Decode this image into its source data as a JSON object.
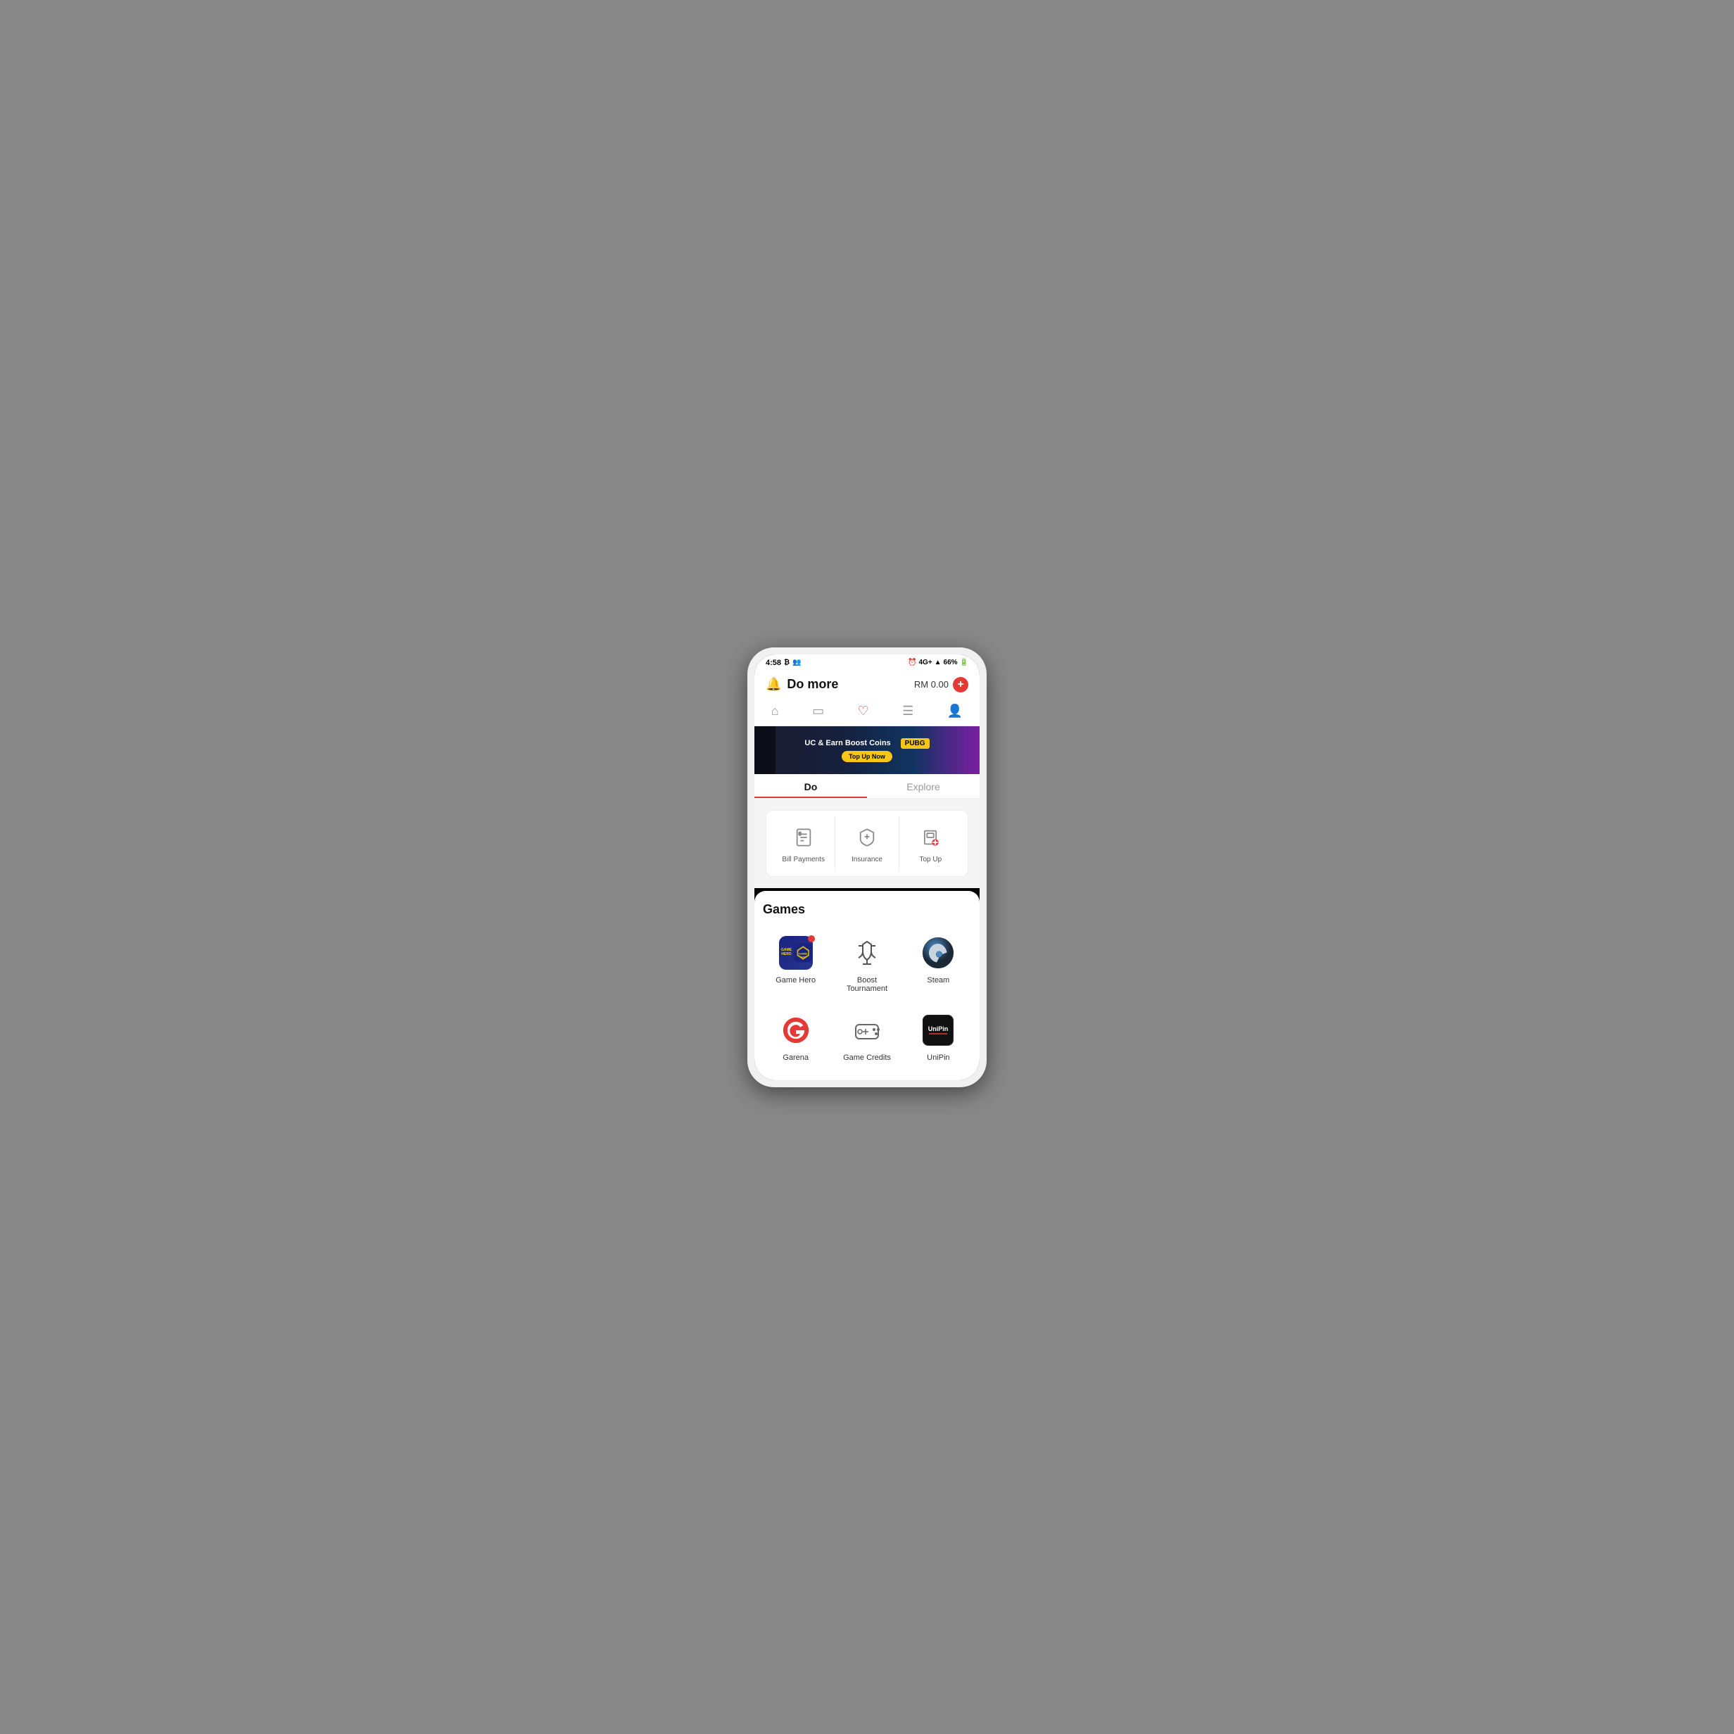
{
  "statusBar": {
    "time": "4:58",
    "battery": "66%",
    "signal": "4G+"
  },
  "header": {
    "title": "Do more",
    "balance": "RM 0.00",
    "addLabel": "+"
  },
  "nav": {
    "items": [
      {
        "icon": "home",
        "label": "Home",
        "active": false
      },
      {
        "icon": "card",
        "label": "Card",
        "active": false
      },
      {
        "icon": "heart",
        "label": "Favourites",
        "active": true
      },
      {
        "icon": "list",
        "label": "List",
        "active": false
      },
      {
        "icon": "person",
        "label": "Profile",
        "active": false
      }
    ]
  },
  "banner": {
    "text": "UC & Earn Boost Coins",
    "buttonLabel": "Top Up Now",
    "gameLabel": "PUBG"
  },
  "tabs": [
    {
      "label": "Do",
      "active": true
    },
    {
      "label": "Explore",
      "active": false
    }
  ],
  "services": [
    {
      "label": "Bill Payments",
      "icon": "bill"
    },
    {
      "label": "Insurance",
      "icon": "insurance"
    },
    {
      "label": "Top Up",
      "icon": "topup"
    }
  ],
  "games": {
    "title": "Games",
    "items": [
      {
        "id": "game-hero",
        "label": "Game Hero",
        "hasBadge": true
      },
      {
        "id": "boost-tournament",
        "label": "Boost Tournament",
        "hasBadge": false
      },
      {
        "id": "steam",
        "label": "Steam",
        "hasBadge": false
      },
      {
        "id": "garena",
        "label": "Garena",
        "hasBadge": false
      },
      {
        "id": "game-credits",
        "label": "Game Credits",
        "hasBadge": false
      },
      {
        "id": "unipin",
        "label": "UniPin",
        "hasBadge": false
      }
    ]
  }
}
